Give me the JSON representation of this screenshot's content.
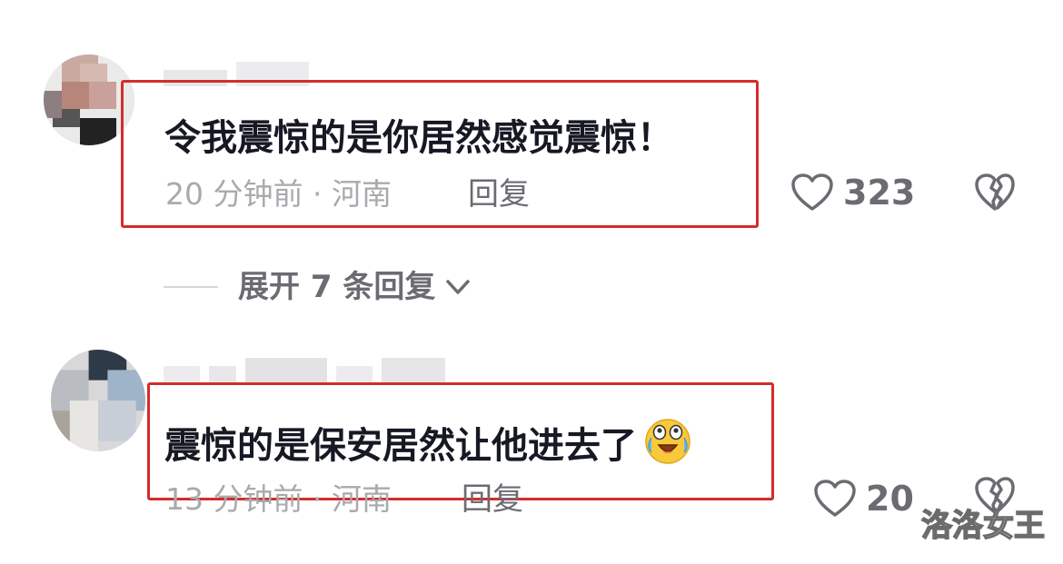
{
  "comments": [
    {
      "text": "令我震惊的是你居然感觉震惊！",
      "meta": "20 分钟前 · 河南",
      "reply_label": "回复",
      "likes": "323"
    },
    {
      "text": "震惊的是保安居然让他进去了",
      "meta": "13 分钟前 · 河南",
      "reply_label": "回复",
      "likes": "20",
      "emoji": "crying-laughing-face"
    }
  ],
  "expand_replies": "展开 7 条回复",
  "watermark": "洛洛女王",
  "colors": {
    "highlight": "#d42c2c",
    "text": "#161823",
    "muted": "#a9aaae",
    "secondary": "#6b6c72"
  },
  "icons": [
    "heart-outline-icon",
    "broken-heart-icon",
    "chevron-down-icon"
  ]
}
